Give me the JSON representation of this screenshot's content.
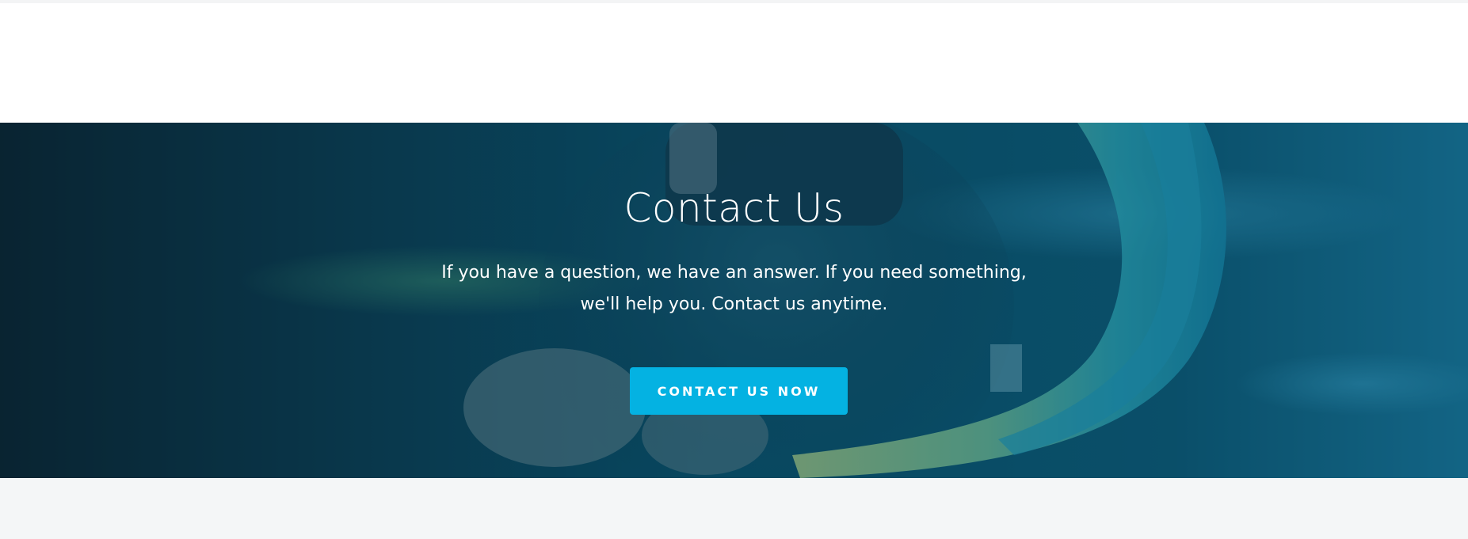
{
  "hero": {
    "title": "Contact Us",
    "description": "If you have a question, we have an answer. If you need something, we'll help you. Contact us anytime.",
    "button_label": "CONTACT US NOW"
  },
  "colors": {
    "button": "#04b2e2",
    "overlay": "#0c4f6a",
    "text": "#ffffff",
    "footer_band": "#f4f6f7"
  }
}
